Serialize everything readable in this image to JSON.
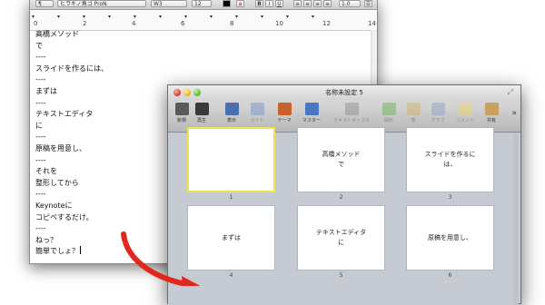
{
  "editor": {
    "toolbar": {
      "paragraph_style": "¶",
      "font_name": "ヒラギノ角ゴ ProN",
      "font_weight": "W3",
      "font_size": "12",
      "format_buttons": [
        "B",
        "I",
        "U"
      ],
      "line_spacing": "1.0"
    },
    "ruler": {
      "labels": [
        "0",
        "2",
        "4",
        "6",
        "8",
        "10",
        "12",
        "14"
      ]
    },
    "lines": [
      "高橋メソッド",
      "で",
      "----",
      "スライドを作るには、",
      "----",
      "まずは",
      "----",
      "テキストエディタ",
      "に",
      "----",
      "原稿を用意し、",
      "----",
      "それを",
      "整形してから",
      "----",
      "Keynoteに",
      "コピペするだけ。",
      "----",
      "ねっ？",
      "簡単でしょ？"
    ]
  },
  "keynote": {
    "window_title": "名称未設定 5",
    "toolbar": [
      {
        "label": "新規",
        "icon": "new-slide-icon",
        "color": "#5a5a5a",
        "enabled": true
      },
      {
        "label": "再生",
        "icon": "play-icon",
        "color": "#3a3a3a",
        "enabled": true
      },
      {
        "label": "表示",
        "icon": "view-icon",
        "color": "#4a6fb0",
        "enabled": true
      },
      {
        "label": "ガイド",
        "icon": "guide-icon",
        "color": "#6f8fc8",
        "enabled": false
      },
      {
        "label": "テーマ",
        "icon": "theme-icon",
        "color": "#c8602a",
        "enabled": true
      },
      {
        "label": "マスター",
        "icon": "master-icon",
        "color": "#4a78c0",
        "enabled": true
      },
      {
        "label": "テキストボックス",
        "icon": "textbox-icon",
        "color": "#8a8a8a",
        "enabled": false
      },
      {
        "label": "図形",
        "icon": "shapes-icon",
        "color": "#60b048",
        "enabled": false
      },
      {
        "label": "表",
        "icon": "table-icon",
        "color": "#d0b060",
        "enabled": false
      },
      {
        "label": "グラフ",
        "icon": "chart-icon",
        "color": "#8aa0c8",
        "enabled": false
      },
      {
        "label": "コメント",
        "icon": "comment-icon",
        "color": "#f0d860",
        "enabled": false
      },
      {
        "label": "共有",
        "icon": "share-icon",
        "color": "#c8a060",
        "enabled": true
      }
    ],
    "overflow_label": "»",
    "slides": [
      {
        "number": "1",
        "lines": [],
        "selected": true
      },
      {
        "number": "2",
        "lines": [
          "高橋メソッド",
          "で"
        ],
        "selected": false
      },
      {
        "number": "3",
        "lines": [
          "スライドを作るに",
          "は、"
        ],
        "selected": false
      },
      {
        "number": "4",
        "lines": [
          "まずは"
        ],
        "selected": false
      },
      {
        "number": "5",
        "lines": [
          "テキストエディタ",
          "に"
        ],
        "selected": false
      },
      {
        "number": "6",
        "lines": [
          "原稿を用意し、"
        ],
        "selected": false
      }
    ]
  },
  "colors": {
    "arrow": "#e0281e",
    "selection": "#f0e24a",
    "slide_bg": "#c5cad3"
  }
}
